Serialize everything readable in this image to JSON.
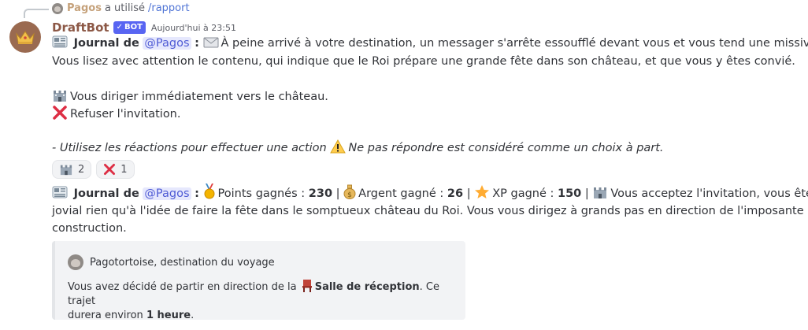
{
  "reply": {
    "user": "Pagos",
    "text": "a utilisé",
    "command": "/rapport"
  },
  "message": {
    "username": "DraftBot",
    "bot_tag": "BOT",
    "timestamp": "Aujourd'hui à 23:51",
    "journal_label": "Journal de",
    "mention": "@Pagos",
    "colon": ":",
    "intro_line1": "À peine arrivé à votre destination, un messager s'arrête essoufflé devant vous et vous tend une missive.",
    "intro_line2": "Vous lisez avec attention le contenu, qui indique que le Roi prépare une grande fête dans son château, et que vous y êtes convié.",
    "choice_1": "Vous diriger immédiatement vers le château.",
    "choice_2": "Refuser l'invitation.",
    "hint_part1": "- Utilisez les réactions pour effectuer une action",
    "hint_part2": "Ne pas répondre est considéré comme un choix à part."
  },
  "reactions": [
    {
      "icon": "castle-icon",
      "count": "2"
    },
    {
      "icon": "cross-icon",
      "count": "1"
    }
  ],
  "result": {
    "journal_label": "Journal de",
    "mention": "@Pagos",
    "colon": ":",
    "points_label": "Points gagnés :",
    "points_value": "230",
    "money_label": "Argent gagné :",
    "money_value": "26",
    "xp_label": "XP gagné :",
    "xp_value": "150",
    "sep": "|",
    "text_line1": "Vous acceptez l'invitation, vous êtes",
    "text_line2": "jovial rien qu'à l'idée de faire la fête dans le somptueux château du Roi. Vous vous dirigez à grands pas en direction de l'imposante",
    "text_line3": "construction."
  },
  "embed": {
    "author": "Pagotortoise, destination du voyage",
    "desc_part1": "Vous avez décidé de partir en direction de la",
    "destination": "Salle de réception",
    "desc_part2": ". Ce trajet",
    "desc_part3": "durera environ",
    "duration": "1 heure",
    "desc_part4": "."
  },
  "colors": {
    "username": "#8c5846",
    "bot_tag": "#5865f2",
    "mention_bg": "#e6e8fd",
    "mention_text": "#4f5bd5",
    "command": "#4f74d6"
  }
}
